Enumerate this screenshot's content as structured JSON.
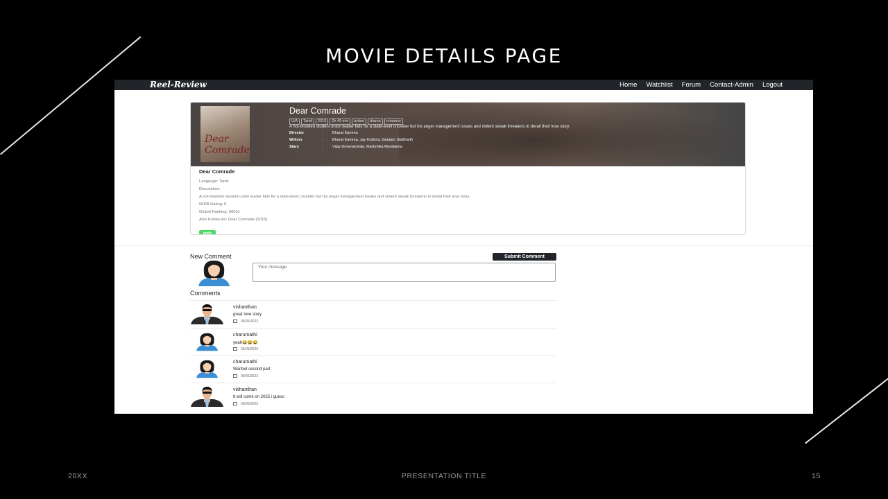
{
  "slide": {
    "title": "MOVIE DETAILS PAGE",
    "footer_left": "20XX",
    "footer_center": "PRESENTATION TITLE",
    "footer_right": "15"
  },
  "app": {
    "brand": "Reel-Review",
    "nav": [
      "Home",
      "Watchlist",
      "Forum",
      "Contact-Admin",
      "Logout"
    ]
  },
  "movie": {
    "title": "Dear Comrade",
    "tags": [
      "U/A",
      "Tamil",
      "2019",
      "2h 49 min",
      "action",
      "drama",
      "romance"
    ],
    "description": "A hot-blooded student union leader falls for a state-level cricketer but his anger management issues and violent streak threatens to derail their love story.",
    "poster_text": "Dear Comrade",
    "crew": [
      {
        "label": "Director",
        "sep": ":",
        "value": "Bharat Kamma"
      },
      {
        "label": "Writers",
        "sep": ":",
        "value": "Bharat Kamma, Jay Krishna, Gautam Siddharth"
      },
      {
        "label": "Stars",
        "sep": ":",
        "value": "Vijay Deverakonda, Rashmika Mandanna"
      }
    ],
    "info_title": "Dear Comrade",
    "language_line": "Language: Tamil",
    "description_label": "Description:",
    "description_text": "A hot-blooded student union leader falls for a state-level cricketer but his anger management issues and violent streak threatens to derail their love story.",
    "rating_line": "IMDB Rating: 8",
    "ranking_line": "Global Ranking: 66031",
    "aka_line": "Also Known As: Dear Comrade (2019)",
    "imdb_button": "imdb"
  },
  "comment_form": {
    "heading": "New Comment",
    "submit_label": "Submit Comment",
    "placeholder": "Your message"
  },
  "comments_heading": "Comments",
  "comments": [
    {
      "user": "vishanthan",
      "text": "great love story",
      "date": "06/05/2023",
      "avatar": "male-avatar-icon"
    },
    {
      "user": "charumathi",
      "text": "yeah😂😂😂",
      "date": "06/05/2023",
      "avatar": "female-avatar-icon"
    },
    {
      "user": "charumathi",
      "text": "Wanted second part",
      "date": "09/05/2023",
      "avatar": "female-avatar-icon"
    },
    {
      "user": "vishanthan",
      "text": "It will come on 2025 i guess",
      "date": "09/05/2023",
      "avatar": "male-avatar-icon"
    }
  ],
  "colors": {
    "navbar": "#212529",
    "imdb": "#4cd964",
    "submit": "#212529"
  }
}
